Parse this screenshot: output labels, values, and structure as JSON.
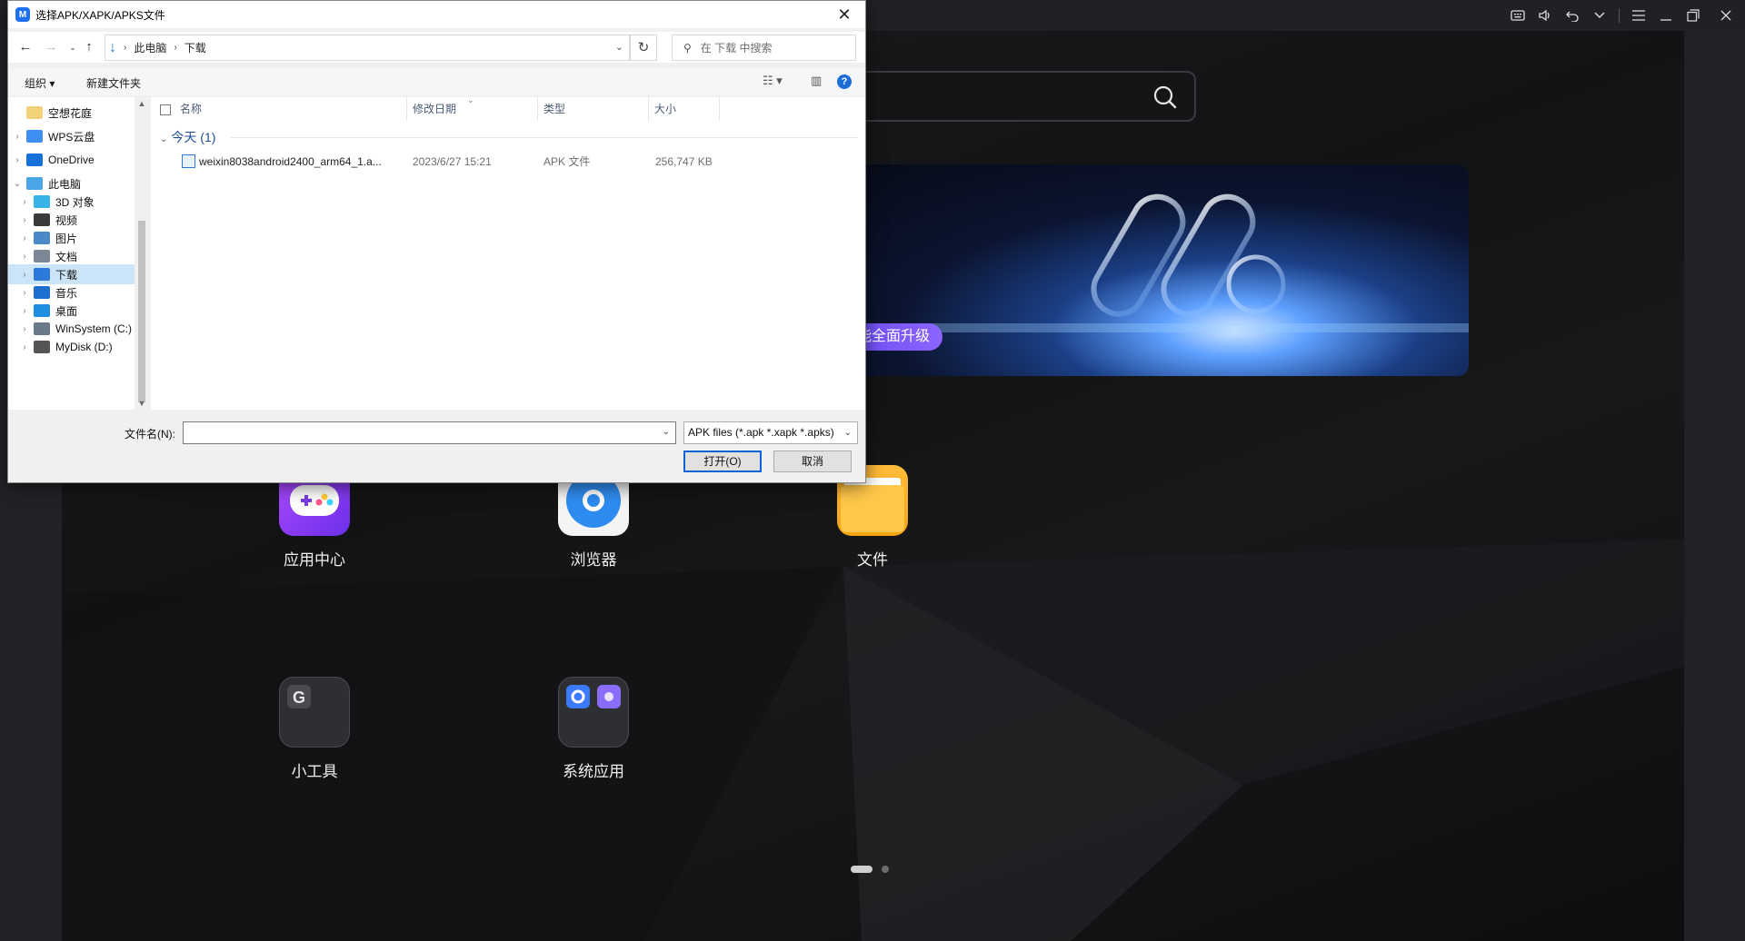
{
  "emulator": {
    "topbar_icons": [
      "keyboard-icon",
      "volume-icon",
      "undo-icon",
      "chevron-down-icon",
      "menu-icon",
      "minimize-icon",
      "restore-icon",
      "close-icon"
    ],
    "banner_badge": "能全面升级",
    "apps": [
      {
        "name": "app-center",
        "label": "应用中心"
      },
      {
        "name": "browser",
        "label": "浏览器"
      },
      {
        "name": "files",
        "label": "文件"
      },
      {
        "name": "tools",
        "label": "小工具"
      },
      {
        "name": "system-apps",
        "label": "系统应用"
      }
    ],
    "page_count": 2,
    "current_page": 1
  },
  "dialog": {
    "title": "选择APK/XAPK/APKS文件",
    "address": {
      "crumbs": [
        "此电脑",
        "下载"
      ]
    },
    "search_placeholder": "在 下载 中搜索",
    "commands": {
      "organize": "组织 ▾",
      "new_folder": "新建文件夹"
    },
    "nav_items": [
      {
        "label": "空想花庭",
        "icon": "folder-icon",
        "color": "#f4d27a"
      },
      {
        "label": "WPS云盘",
        "icon": "cloud-icon",
        "color": "#3f8ef2"
      },
      {
        "label": "OneDrive",
        "icon": "onedrive-icon",
        "color": "#1672d8"
      },
      {
        "label": "此电脑",
        "icon": "computer-icon",
        "color": "#4aa6e8"
      },
      {
        "label": "3D 对象",
        "icon": "3d-objects-icon",
        "color": "#37b3e6"
      },
      {
        "label": "视频",
        "icon": "video-icon",
        "color": "#3a3a3a"
      },
      {
        "label": "图片",
        "icon": "pictures-icon",
        "color": "#4a88c7"
      },
      {
        "label": "文档",
        "icon": "documents-icon",
        "color": "#7b8794"
      },
      {
        "label": "下载",
        "icon": "download-icon",
        "color": "#2b79d8"
      },
      {
        "label": "音乐",
        "icon": "music-icon",
        "color": "#1f6fd1"
      },
      {
        "label": "桌面",
        "icon": "desktop-icon",
        "color": "#1f8ee0"
      },
      {
        "label": "WinSystem (C:)",
        "icon": "drive-icon",
        "color": "#6b7a88"
      },
      {
        "label": "MyDisk (D:)",
        "icon": "drive-icon",
        "color": "#555555"
      }
    ],
    "columns": {
      "name": "名称",
      "date": "修改日期",
      "type": "类型",
      "size": "大小"
    },
    "group": "今天 (1)",
    "files": [
      {
        "name": "weixin8038android2400_arm64_1.a...",
        "date": "2023/6/27 15:21",
        "type": "APK 文件",
        "size": "256,747 KB"
      }
    ],
    "filename_label": "文件名(N):",
    "filename_value": "",
    "filetype": "APK files (*.apk *.xapk *.apks)",
    "open_button": "打开(O)",
    "cancel_button": "取消"
  }
}
